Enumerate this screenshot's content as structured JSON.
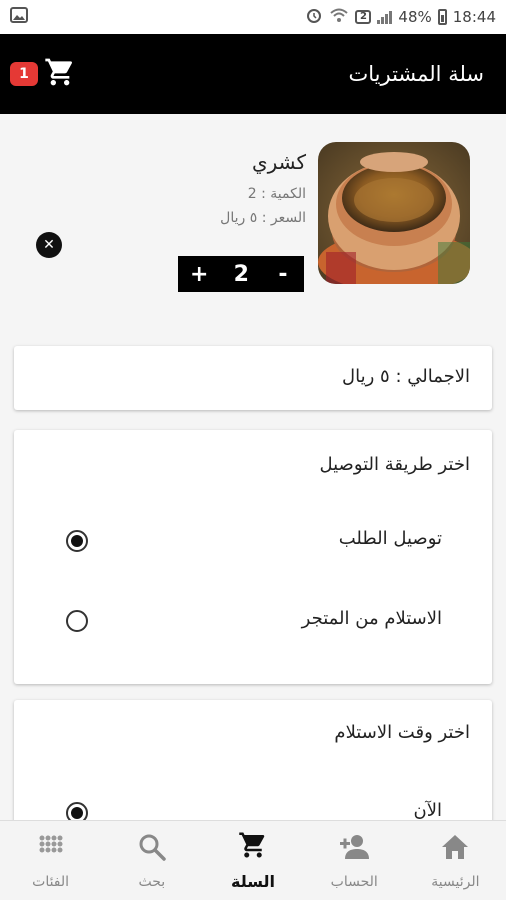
{
  "status_bar": {
    "battery": "48%",
    "time": "18:44",
    "sim": "2"
  },
  "header": {
    "title": "سلة المشتريات",
    "cart_count": "1"
  },
  "cart_item": {
    "name": "كشري",
    "quantity_label": "الكمية : 2",
    "price_label": "السعر : ٥ ريال",
    "stepper": {
      "plus": "+",
      "value": "2",
      "minus": "-"
    },
    "image_icon": "koshari-dish-image"
  },
  "total": {
    "label": "الاجمالي : ٥ ريال"
  },
  "delivery": {
    "heading": "اختر طريقة التوصيل",
    "options": [
      {
        "label": "توصيل الطلب",
        "selected": true
      },
      {
        "label": "الاستلام من المتجر",
        "selected": false
      }
    ]
  },
  "pickup_time": {
    "heading": "اختر وقت الاستلام",
    "options": [
      {
        "label": "الآن",
        "selected": true
      }
    ]
  },
  "bottom_nav": {
    "items": [
      {
        "label": "الفئات",
        "icon": "grid-icon",
        "active": false
      },
      {
        "label": "بحث",
        "icon": "search-icon",
        "active": false
      },
      {
        "label": "السلة",
        "icon": "cart-icon",
        "active": true
      },
      {
        "label": "الحساب",
        "icon": "add-user-icon",
        "active": false
      },
      {
        "label": "الرئيسية",
        "icon": "home-icon",
        "active": false
      }
    ]
  },
  "colors": {
    "app_bar": "#000000",
    "badge": "#e53935",
    "nav_active": "#111111",
    "nav_inactive": "#888888"
  }
}
